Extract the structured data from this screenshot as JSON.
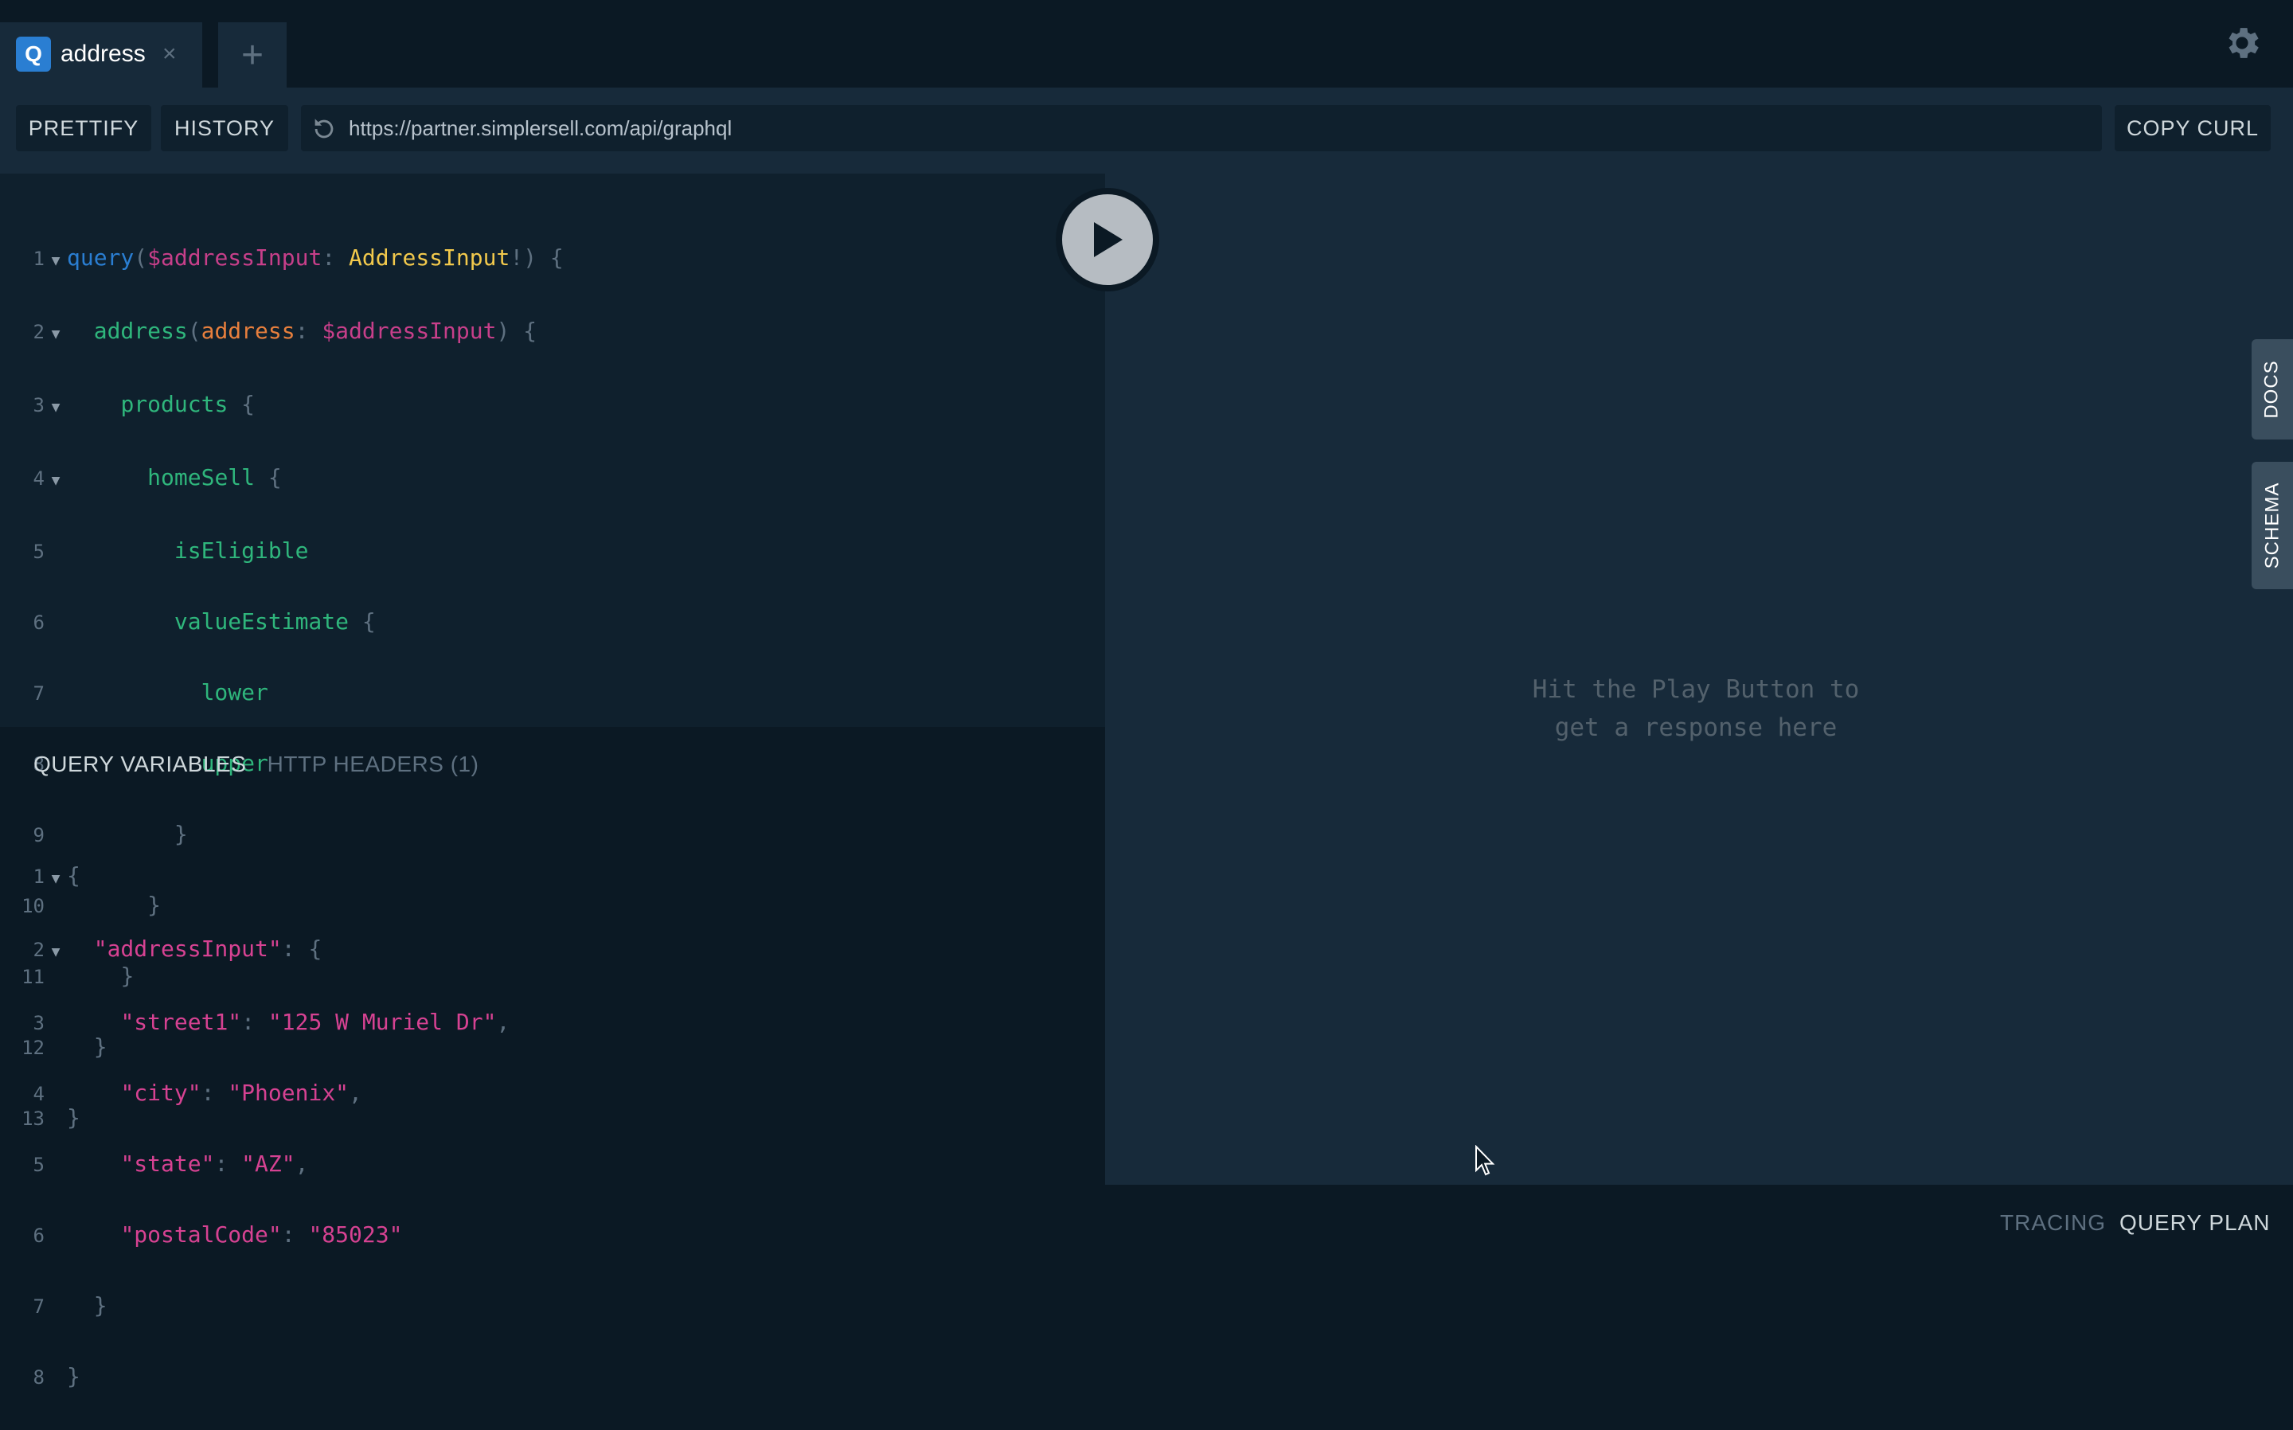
{
  "tab": {
    "badge": "Q",
    "title": "address",
    "close_glyph": "×",
    "new_tab_glyph": "+"
  },
  "toolbar": {
    "prettify_label": "PRETTIFY",
    "history_label": "HISTORY",
    "url": "https://partner.simplersell.com/api/graphql",
    "copy_curl_label": "COPY CURL"
  },
  "query_lines": [
    {
      "n": "1",
      "fold": true
    },
    {
      "n": "2",
      "fold": true
    },
    {
      "n": "3",
      "fold": true
    },
    {
      "n": "4",
      "fold": true
    },
    {
      "n": "5",
      "fold": false
    },
    {
      "n": "6",
      "fold": false
    },
    {
      "n": "7",
      "fold": false
    },
    {
      "n": "8",
      "fold": false
    },
    {
      "n": "9",
      "fold": false
    },
    {
      "n": "10",
      "fold": false
    },
    {
      "n": "11",
      "fold": false
    },
    {
      "n": "12",
      "fold": false
    },
    {
      "n": "13",
      "fold": false
    }
  ],
  "query": {
    "keyword": "query",
    "var": "$addressInput",
    "type": "AddressInput",
    "bang": "!",
    "root_field": "address",
    "arg_name": "address",
    "arg_var": "$addressInput",
    "f_products": "products",
    "f_homeSell": "homeSell",
    "f_isEligible": "isEligible",
    "f_valueEstimate": "valueEstimate",
    "f_lower": "lower",
    "f_upper": "upper"
  },
  "vars_panel": {
    "query_variables_label": "QUERY VARIABLES",
    "http_headers_label": "HTTP HEADERS (1)"
  },
  "variables": {
    "root_key": "\"addressInput\"",
    "street1_key": "\"street1\"",
    "street1_val": "\"125 W Muriel Dr\"",
    "city_key": "\"city\"",
    "city_val": "\"Phoenix\"",
    "state_key": "\"state\"",
    "state_val": "\"AZ\"",
    "postal_key": "\"postalCode\"",
    "postal_val": "\"85023\""
  },
  "results": {
    "placeholder_line1": "Hit the Play Button to",
    "placeholder_line2": "get a response here"
  },
  "side_tabs": {
    "docs": "DOCS",
    "schema": "SCHEMA"
  },
  "footer": {
    "tracing": "TRACING",
    "query_plan": "QUERY PLAN"
  },
  "icons": {
    "play": "play-icon",
    "gear": "gear-icon",
    "reload": "reload-icon",
    "close": "close-icon",
    "plus": "plus-icon",
    "cursor": "mouse-cursor-icon"
  },
  "colors": {
    "accent": "#2a7ed2",
    "background": "#0b1924",
    "panel": "#172a3a"
  }
}
